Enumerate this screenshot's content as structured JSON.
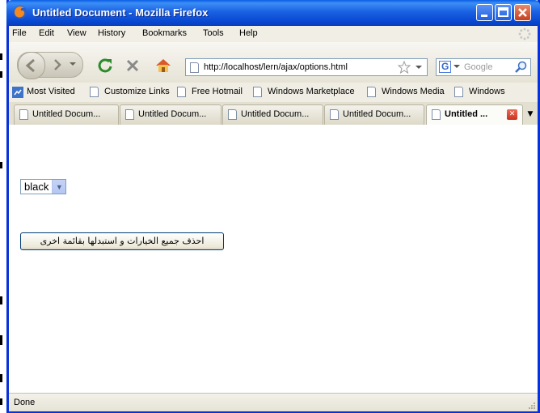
{
  "window": {
    "title": "Untitled Document - Mozilla Firefox"
  },
  "menu": [
    "File",
    "Edit",
    "View",
    "History",
    "Bookmarks",
    "Tools",
    "Help"
  ],
  "nav": {
    "url": "http://localhost/lern/ajax/options.html",
    "search_placeholder": "Google"
  },
  "bookmarks": [
    "Most Visited",
    "Customize Links",
    "Free Hotmail",
    "Windows Marketplace",
    "Windows Media",
    "Windows"
  ],
  "tabs": [
    "Untitled Docum...",
    "Untitled Docum...",
    "Untitled Docum...",
    "Untitled Docum...",
    "Untitled ..."
  ],
  "page": {
    "select_value": "black",
    "button_label": "احذف جميع الخيارات و استبدلها بقائمة اخرى"
  },
  "status": "Done",
  "colors": {
    "titlebar": "#0a5ee4",
    "chrome": "#ece9d8",
    "close": "#c8321f"
  },
  "icons": [
    "firefox-logo-icon",
    "back-icon",
    "forward-icon",
    "reload-icon",
    "stop-icon",
    "home-icon",
    "star-icon",
    "google-icon",
    "search-icon"
  ]
}
